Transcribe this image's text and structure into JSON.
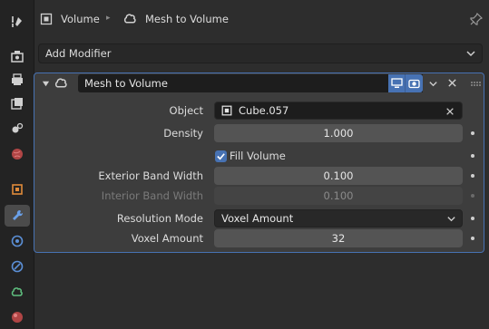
{
  "header": {
    "object_label": "Volume",
    "modifier_label": "Mesh to Volume"
  },
  "add_modifier": {
    "label": "Add Modifier"
  },
  "modifier": {
    "name": "Mesh to Volume",
    "rows": {
      "object": {
        "label": "Object",
        "value": "Cube.057"
      },
      "density": {
        "label": "Density",
        "value": "1.000"
      },
      "fill_volume": {
        "label": "Fill Volume",
        "checked": true
      },
      "exterior_band_width": {
        "label": "Exterior Band Width",
        "value": "0.100"
      },
      "interior_band_width": {
        "label": "Interior Band Width",
        "value": "0.100"
      },
      "resolution_mode": {
        "label": "Resolution Mode",
        "value": "Voxel Amount"
      },
      "voxel_amount": {
        "label": "Voxel Amount",
        "value": "32"
      }
    }
  },
  "colors": {
    "accent": "#4772b3",
    "panel_bg": "#3d3d3d",
    "field_bg": "#545454"
  },
  "sidebar_icons": [
    "tool-icon",
    "render-icon",
    "output-icon",
    "view-layer-icon",
    "scene-icon",
    "world-icon",
    "object-icon",
    "modifier-wrench-icon",
    "particles-icon",
    "physics-icon",
    "constraints-icon",
    "data-icon",
    "material-icon"
  ]
}
